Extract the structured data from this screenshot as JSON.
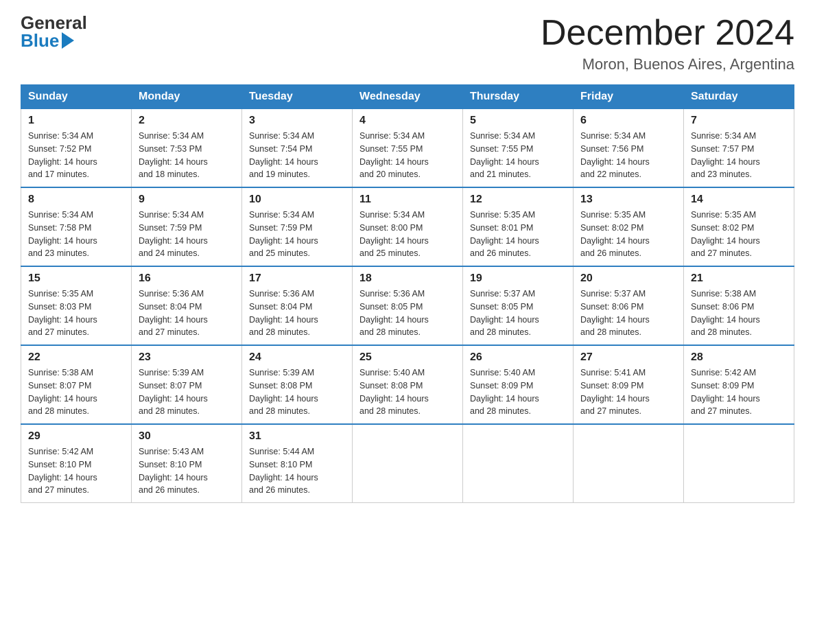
{
  "header": {
    "logo_general": "General",
    "logo_blue": "Blue",
    "month_title": "December 2024",
    "location": "Moron, Buenos Aires, Argentina"
  },
  "calendar": {
    "days_of_week": [
      "Sunday",
      "Monday",
      "Tuesday",
      "Wednesday",
      "Thursday",
      "Friday",
      "Saturday"
    ],
    "weeks": [
      [
        {
          "day": "1",
          "sunrise": "5:34 AM",
          "sunset": "7:52 PM",
          "daylight": "14 hours and 17 minutes."
        },
        {
          "day": "2",
          "sunrise": "5:34 AM",
          "sunset": "7:53 PM",
          "daylight": "14 hours and 18 minutes."
        },
        {
          "day": "3",
          "sunrise": "5:34 AM",
          "sunset": "7:54 PM",
          "daylight": "14 hours and 19 minutes."
        },
        {
          "day": "4",
          "sunrise": "5:34 AM",
          "sunset": "7:55 PM",
          "daylight": "14 hours and 20 minutes."
        },
        {
          "day": "5",
          "sunrise": "5:34 AM",
          "sunset": "7:55 PM",
          "daylight": "14 hours and 21 minutes."
        },
        {
          "day": "6",
          "sunrise": "5:34 AM",
          "sunset": "7:56 PM",
          "daylight": "14 hours and 22 minutes."
        },
        {
          "day": "7",
          "sunrise": "5:34 AM",
          "sunset": "7:57 PM",
          "daylight": "14 hours and 23 minutes."
        }
      ],
      [
        {
          "day": "8",
          "sunrise": "5:34 AM",
          "sunset": "7:58 PM",
          "daylight": "14 hours and 23 minutes."
        },
        {
          "day": "9",
          "sunrise": "5:34 AM",
          "sunset": "7:59 PM",
          "daylight": "14 hours and 24 minutes."
        },
        {
          "day": "10",
          "sunrise": "5:34 AM",
          "sunset": "7:59 PM",
          "daylight": "14 hours and 25 minutes."
        },
        {
          "day": "11",
          "sunrise": "5:34 AM",
          "sunset": "8:00 PM",
          "daylight": "14 hours and 25 minutes."
        },
        {
          "day": "12",
          "sunrise": "5:35 AM",
          "sunset": "8:01 PM",
          "daylight": "14 hours and 26 minutes."
        },
        {
          "day": "13",
          "sunrise": "5:35 AM",
          "sunset": "8:02 PM",
          "daylight": "14 hours and 26 minutes."
        },
        {
          "day": "14",
          "sunrise": "5:35 AM",
          "sunset": "8:02 PM",
          "daylight": "14 hours and 27 minutes."
        }
      ],
      [
        {
          "day": "15",
          "sunrise": "5:35 AM",
          "sunset": "8:03 PM",
          "daylight": "14 hours and 27 minutes."
        },
        {
          "day": "16",
          "sunrise": "5:36 AM",
          "sunset": "8:04 PM",
          "daylight": "14 hours and 27 minutes."
        },
        {
          "day": "17",
          "sunrise": "5:36 AM",
          "sunset": "8:04 PM",
          "daylight": "14 hours and 28 minutes."
        },
        {
          "day": "18",
          "sunrise": "5:36 AM",
          "sunset": "8:05 PM",
          "daylight": "14 hours and 28 minutes."
        },
        {
          "day": "19",
          "sunrise": "5:37 AM",
          "sunset": "8:05 PM",
          "daylight": "14 hours and 28 minutes."
        },
        {
          "day": "20",
          "sunrise": "5:37 AM",
          "sunset": "8:06 PM",
          "daylight": "14 hours and 28 minutes."
        },
        {
          "day": "21",
          "sunrise": "5:38 AM",
          "sunset": "8:06 PM",
          "daylight": "14 hours and 28 minutes."
        }
      ],
      [
        {
          "day": "22",
          "sunrise": "5:38 AM",
          "sunset": "8:07 PM",
          "daylight": "14 hours and 28 minutes."
        },
        {
          "day": "23",
          "sunrise": "5:39 AM",
          "sunset": "8:07 PM",
          "daylight": "14 hours and 28 minutes."
        },
        {
          "day": "24",
          "sunrise": "5:39 AM",
          "sunset": "8:08 PM",
          "daylight": "14 hours and 28 minutes."
        },
        {
          "day": "25",
          "sunrise": "5:40 AM",
          "sunset": "8:08 PM",
          "daylight": "14 hours and 28 minutes."
        },
        {
          "day": "26",
          "sunrise": "5:40 AM",
          "sunset": "8:09 PM",
          "daylight": "14 hours and 28 minutes."
        },
        {
          "day": "27",
          "sunrise": "5:41 AM",
          "sunset": "8:09 PM",
          "daylight": "14 hours and 27 minutes."
        },
        {
          "day": "28",
          "sunrise": "5:42 AM",
          "sunset": "8:09 PM",
          "daylight": "14 hours and 27 minutes."
        }
      ],
      [
        {
          "day": "29",
          "sunrise": "5:42 AM",
          "sunset": "8:10 PM",
          "daylight": "14 hours and 27 minutes."
        },
        {
          "day": "30",
          "sunrise": "5:43 AM",
          "sunset": "8:10 PM",
          "daylight": "14 hours and 26 minutes."
        },
        {
          "day": "31",
          "sunrise": "5:44 AM",
          "sunset": "8:10 PM",
          "daylight": "14 hours and 26 minutes."
        },
        null,
        null,
        null,
        null
      ]
    ],
    "labels": {
      "sunrise": "Sunrise:",
      "sunset": "Sunset:",
      "daylight": "Daylight:"
    }
  }
}
